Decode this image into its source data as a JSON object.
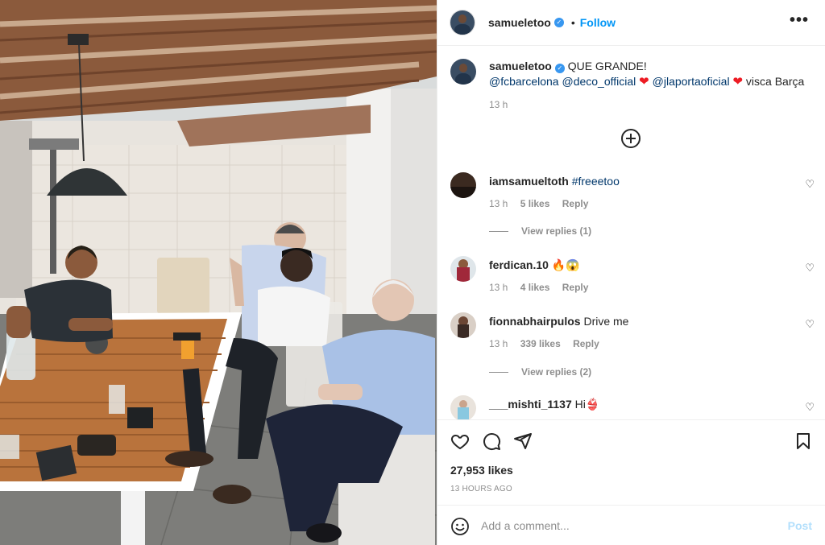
{
  "post": {
    "username": "samueletoo",
    "follow_label": "Follow",
    "more_label": "•••"
  },
  "caption": {
    "username": "samueletoo",
    "text": "QUE GRANDE!",
    "mention1": "@fcbarcelona",
    "mention2": "@deco_official",
    "mention3": "@jlaportaoficial",
    "tail": "visca Barça",
    "heart": "❤",
    "time": "13 h"
  },
  "comments": [
    {
      "username": "iamsamueltoth",
      "text": "#freeetoo",
      "time": "13 h",
      "likes": "5 likes",
      "reply": "Reply",
      "view_replies": "View replies (1)"
    },
    {
      "username": "ferdican.10",
      "text": "🔥😱",
      "time": "13 h",
      "likes": "4 likes",
      "reply": "Reply"
    },
    {
      "username": "fionnabhairpulos",
      "text": "Drive me",
      "time": "13 h",
      "likes": "339 likes",
      "reply": "Reply",
      "view_replies": "View replies (2)"
    },
    {
      "username": "___mishti_1137",
      "text": "Hi👙"
    }
  ],
  "footer": {
    "likes": "27,953 likes",
    "posted": "13 HOURS AGO",
    "comment_placeholder": "Add a comment...",
    "post_label": "Post"
  },
  "icons": {
    "verified": "verified-badge-icon",
    "add_comment": "plus-circle-icon",
    "like": "heart-outline-icon",
    "comment": "speech-bubble-icon",
    "share": "paper-plane-icon",
    "save": "bookmark-icon",
    "emoji": "smiley-icon"
  },
  "colors": {
    "link": "#0095f6",
    "mention": "#00376b",
    "muted": "#8e8e8e",
    "heart": "#ed1c24"
  }
}
